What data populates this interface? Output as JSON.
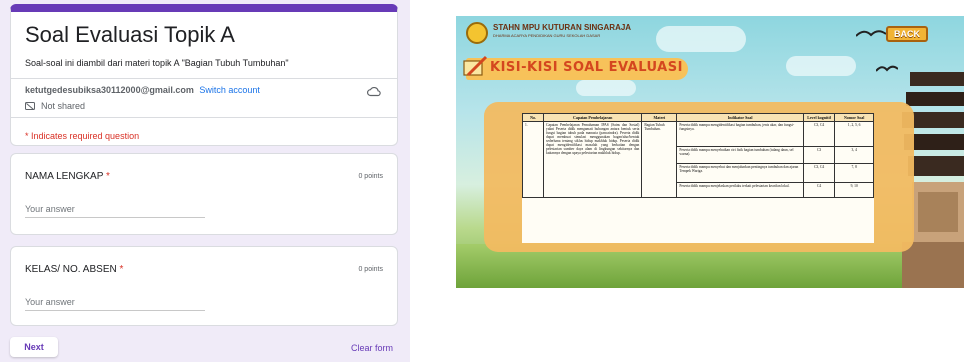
{
  "form": {
    "title": "Soal Evaluasi Topik A",
    "description": "Soal-soal ini diambil dari materi topik A \"Bagian Tubuh Tumbuhan\"",
    "account_email": "ketutgedesubiksa30112000@gmail.com",
    "switch_account": "Switch account",
    "shared_status": "Not shared",
    "required_note": "* Indicates required question",
    "questions": [
      {
        "label": "NAMA LENGKAP",
        "required_mark": "*",
        "points": "0 points",
        "placeholder": "Your answer"
      },
      {
        "label": "KELAS/ NO. ABSEN",
        "required_mark": "*",
        "points": "0 points",
        "placeholder": "Your answer"
      }
    ],
    "next_label": "Next",
    "clear_label": "Clear form",
    "accent_color": "#673ab7"
  },
  "slide": {
    "institution": "STAHN MPU KUTURAN SINGARAJA",
    "institution_sub": "DHARMA ACARYA PENDIDIKAN GURU SEKOLAH DASAR",
    "back_label": "BACK",
    "heading": "KISI-KISI SOAL EVALUASI",
    "table": {
      "headers": [
        "No.",
        "Capaian Pembelajaran",
        "Materi",
        "Indikator Soal",
        "Level kognitif",
        "Nomor Soal"
      ],
      "row_no": "1.",
      "capaian": "Capaian Pembelajaran Pemahaman IPAS (Sains dan Sosial) yakni Peserta didik mengamati hubungan antara bentuk serta fungsi bagian tubuh pada manusia (pancaindra). Peserta didik dapat membuat simulasi menggunakan bagan/alur/bentuk sederhana tentang siklus hidup makhluk hidup. Peserta didik dapat mengidentifikasi masalah yang berkaitan dengan pelestarian sumber daya alam di lingkungan sekitarnya dan kaitannya dengan upaya pelestarian makhluk hidup.",
      "materi": "Bagian Tubuh Tumbuhan.",
      "indikator": [
        {
          "text": "Peserta didik mampu mengidentifikasi bagian tumbuhan, jenis akar, dan fungsi-fungsinya.",
          "level": "C3, C4",
          "nomor": "1, 2, 5, 6"
        },
        {
          "text": "Peserta didik mampu menyebutkan ciri fisik bagian tumbuhan (tulang daun, sel warna).",
          "level": "C3",
          "nomor": "3, 4"
        },
        {
          "text": "Peserta didik mampu menyebut dan menjabarkan pentingnya tumbuhan dan ajaran Tempek Wariga.",
          "level": "C3, C4",
          "nomor": "7, 8"
        },
        {
          "text": "Peserta didik mampu menjelaskan perilaku terkait pelestarian kearifan lokal.",
          "level": "C4",
          "nomor": "9, 10"
        }
      ]
    }
  }
}
